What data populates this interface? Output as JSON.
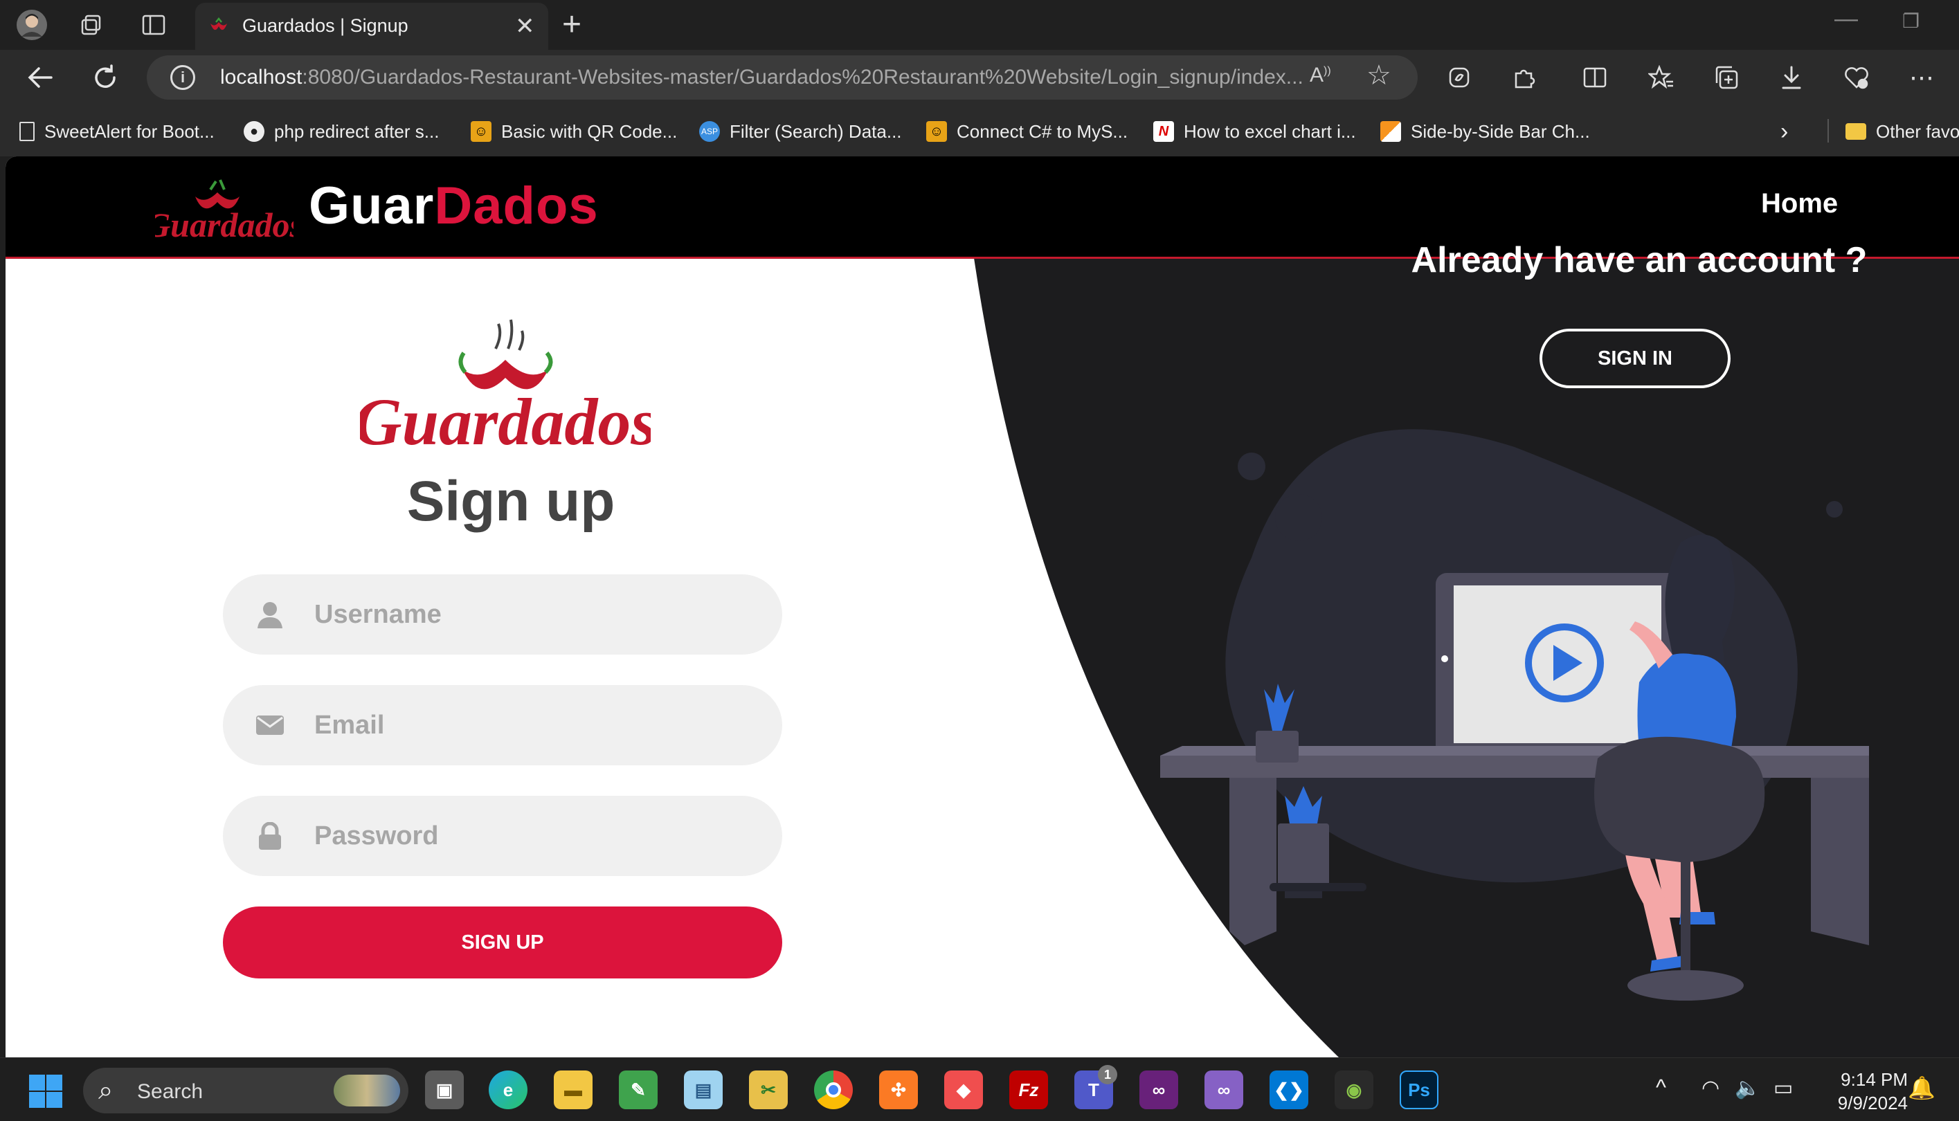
{
  "browser": {
    "tab_title": "Guardados | Signup",
    "url_host": "localhost",
    "url_rest": ":8080/Guardados-Restaurant-Websites-master/Guardados%20Restaurant%20Website/Login_signup/index...",
    "bookmarks": [
      {
        "label": "SweetAlert for Boot...",
        "icon": "document-icon"
      },
      {
        "label": "php redirect after s...",
        "icon": "github-icon"
      },
      {
        "label": "Basic with QR Code...",
        "icon": "codeproject-icon"
      },
      {
        "label": "Filter (Search) Data...",
        "icon": "aspsnippets-icon"
      },
      {
        "label": "Connect C# to MyS...",
        "icon": "codeproject-icon"
      },
      {
        "label": "How to excel chart i...",
        "icon": "n-logo-icon"
      },
      {
        "label": "Side-by-Side Bar Ch...",
        "icon": "chart-icon"
      }
    ],
    "other_favorites": "Other favo"
  },
  "site": {
    "brand_part1": "Guar",
    "brand_part2": "Dados",
    "nav_home": "Home",
    "logo_text": "Guardados",
    "accent_color": "#dc143c"
  },
  "signin_panel": {
    "heading": "Already have an account ?",
    "button": "SIGN IN"
  },
  "signup_form": {
    "title": "Sign up",
    "username_placeholder": "Username",
    "email_placeholder": "Email",
    "password_placeholder": "Password",
    "button": "SIGN UP"
  },
  "taskbar": {
    "search_label": "Search",
    "time": "9:14 PM",
    "date": "9/9/2024",
    "teams_badge": "1",
    "ps_label": "Ps"
  }
}
